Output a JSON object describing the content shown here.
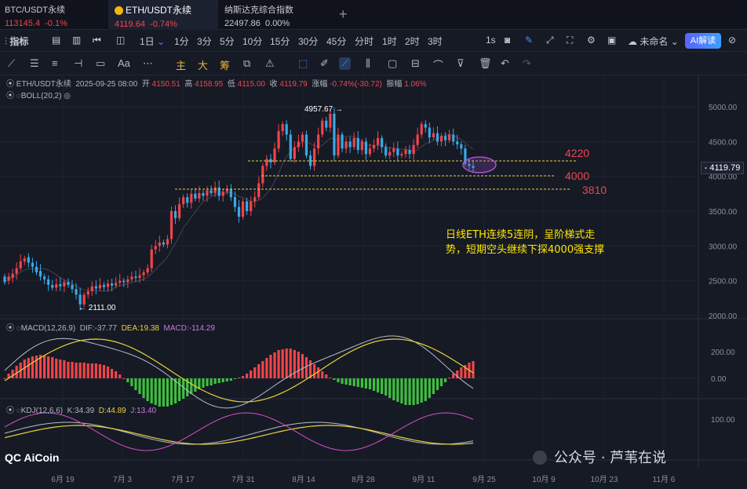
{
  "tabs": [
    {
      "name": "BTC/USDT永续",
      "price": "113145.4",
      "change": "-0.1%"
    },
    {
      "name": "ETH/USDT永续",
      "price": "4119.64",
      "change": "-0.74%"
    },
    {
      "name": "纳斯达克综合指数",
      "price": "22497.86",
      "change": "0.00%"
    }
  ],
  "toolbar": {
    "indicators": "指标",
    "intervals": [
      "1日",
      "1分",
      "3分",
      "5分",
      "10分",
      "15分",
      "30分",
      "45分",
      "分时",
      "1时",
      "2时",
      "3时"
    ],
    "seconds": "1s",
    "unnamed": "未命名",
    "ai": "AI解读"
  },
  "drawtools": {
    "main": "主",
    "big": "大",
    "chip": "筹",
    "text": "Aa"
  },
  "ohlc": {
    "symbol": "ETH/USDT永续",
    "date": "2025-09-25 08:00",
    "open_label": "开",
    "open": "4150.51",
    "high_label": "高",
    "high": "4158.95",
    "low_label": "低",
    "low": "4115.00",
    "close_label": "收",
    "close": "4119.79",
    "chg_label": "涨幅",
    "chg": "-0.74%(-30.72)",
    "amp_label": "振幅",
    "amp": "1.06%"
  },
  "boll": "BOLL(20,2)",
  "macd": {
    "label": "MACD(12,26,9)",
    "dif": "DIF:-37.77",
    "dea": "DEA:19.38",
    "macd": "MACD:-114.29"
  },
  "kdj": {
    "label": "KDJ(12,6,6)",
    "k": "K:34.39",
    "d": "D:44.89",
    "j": "J:13.40"
  },
  "current_price": "4119.79",
  "annotations": {
    "high_mark": "4957.67",
    "low_mark": "2111.00",
    "level_1": "4220",
    "level_2": "4000",
    "level_3": "3810",
    "comment_line1": "日线ETH连续5连阴，呈阶梯式走",
    "comment_line2": "势，短期空头继续下探4000强支撑"
  },
  "price_axis": [
    "5000.00",
    "4500.00",
    "4000.00",
    "3500.00",
    "3000.00",
    "2500.00",
    "2000.00"
  ],
  "macd_axis": [
    "200.00",
    "0.00"
  ],
  "kdj_axis": [
    "100.00"
  ],
  "date_axis": [
    "6月 19",
    "7月 3",
    "7月 17",
    "7月 31",
    "8月 14",
    "8月 28",
    "9月 11",
    "9月 25",
    "10月 9",
    "10月 23",
    "11月 6"
  ],
  "watermark": "AiCoin",
  "wechat": "公众号 · 芦苇在说",
  "colors": {
    "up": "#f0454a",
    "down": "#38a9e8",
    "accent": "#4c8dff"
  }
}
